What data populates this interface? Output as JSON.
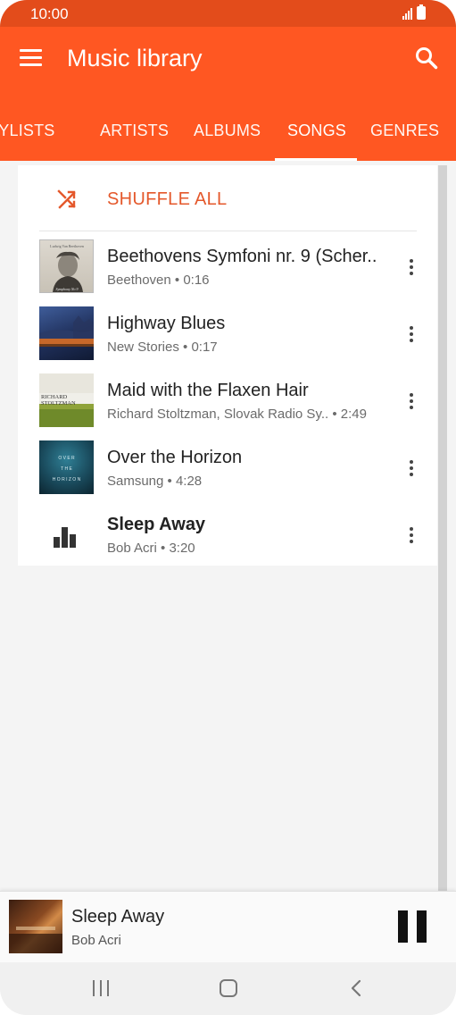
{
  "status_bar": {
    "time": "10:00"
  },
  "header": {
    "title": "Music library"
  },
  "tabs": [
    {
      "label": "PLAYLISTS",
      "active": false
    },
    {
      "label": "ARTISTS",
      "active": false
    },
    {
      "label": "ALBUMS",
      "active": false
    },
    {
      "label": "SONGS",
      "active": true
    },
    {
      "label": "GENRES",
      "active": false
    }
  ],
  "shuffle": {
    "label": "SHUFFLE ALL"
  },
  "songs": [
    {
      "title": "Beethovens Symfoni nr. 9 (Scher..",
      "subtitle": "Beethoven • 0:16"
    },
    {
      "title": "Highway Blues",
      "subtitle": "New Stories • 0:17"
    },
    {
      "title": "Maid with the Flaxen Hair",
      "subtitle": "Richard Stoltzman, Slovak Radio Sy..  • 2:49"
    },
    {
      "title": "Over the Horizon",
      "subtitle": "Samsung • 4:28"
    },
    {
      "title": "Sleep Away",
      "subtitle": "Bob Acri • 3:20",
      "now_playing": true
    }
  ],
  "album_art_text": {
    "beethoven_top": "Ludwig Van Beethoven",
    "beethoven_bottom": "Symphony No 9",
    "stoltzman_name_1": "RICHARD",
    "stoltzman_name_2": "STOLTZMAN",
    "horizon_1": "O V E R",
    "horizon_2": "T H E",
    "horizon_3": "H O R I Z O N"
  },
  "mini_player": {
    "title": "Sleep Away",
    "artist": "Bob Acri"
  },
  "colors": {
    "header": "#ff5722",
    "status": "#e34c1b",
    "accent": "#e4582b"
  }
}
